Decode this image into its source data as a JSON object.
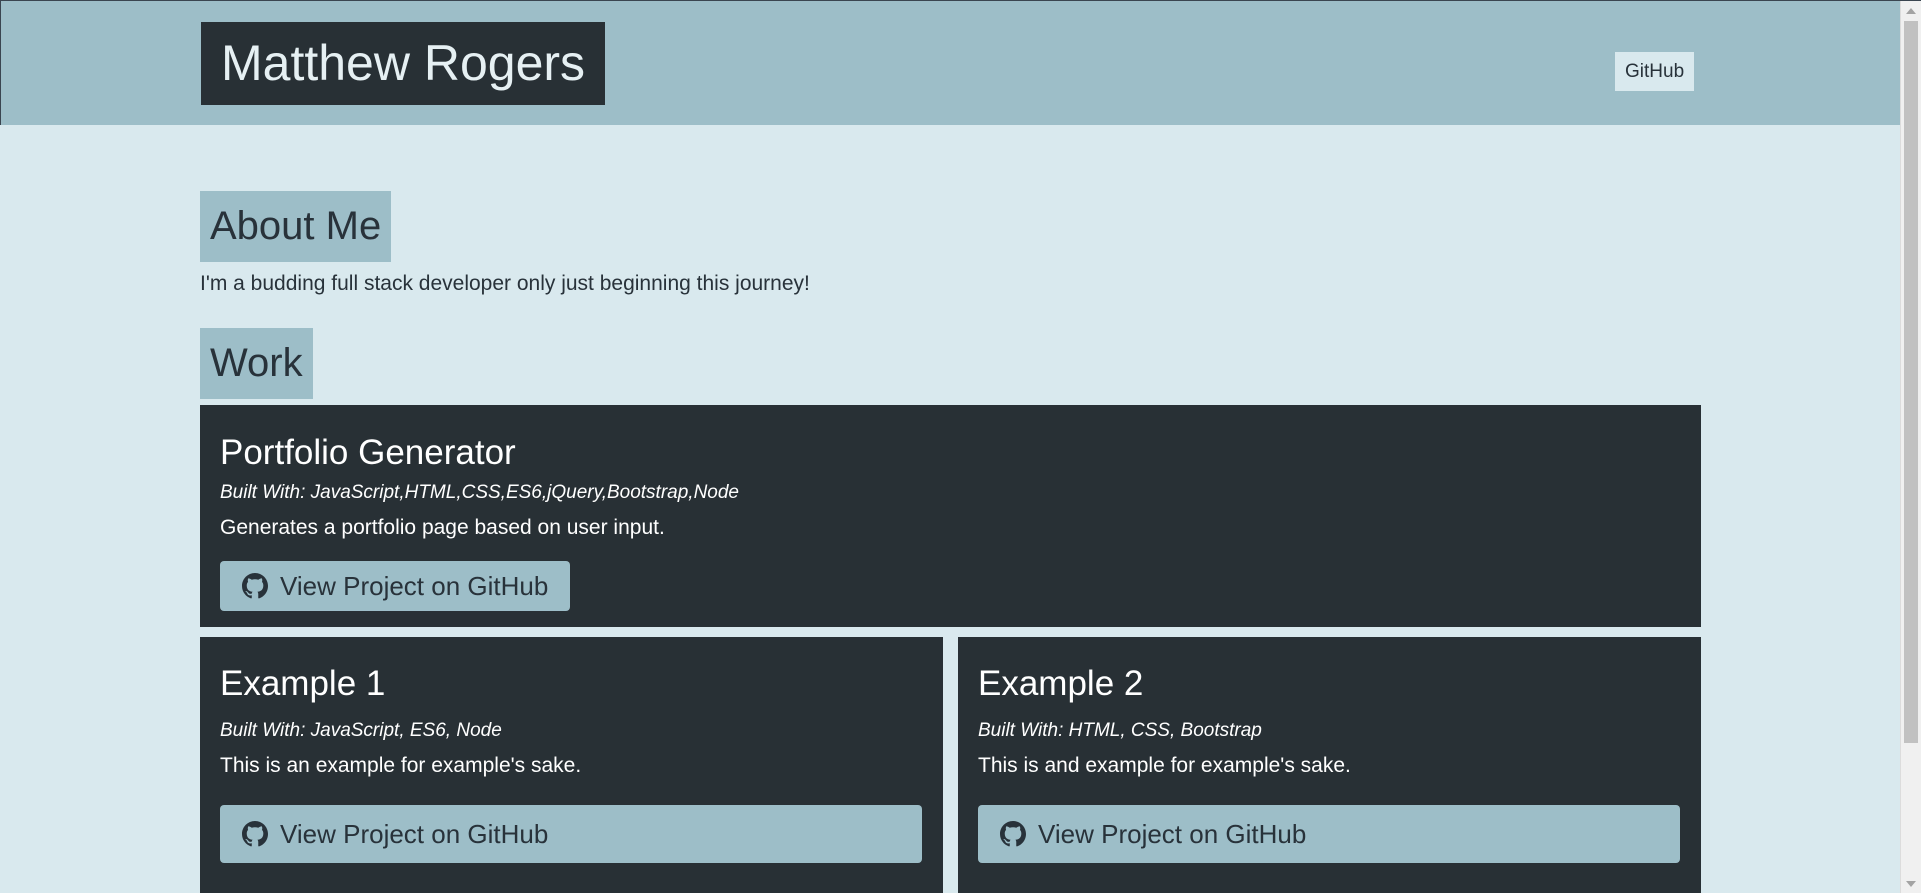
{
  "header": {
    "brand": "Matthew Rogers",
    "nav_link": "GitHub"
  },
  "about": {
    "heading": "About Me",
    "text": "I'm a budding full stack developer only just beginning this journey!"
  },
  "work": {
    "heading": "Work",
    "projects": [
      {
        "title": "Portfolio Generator",
        "built_with": "Built With: JavaScript,HTML,CSS,ES6,jQuery,Bootstrap,Node",
        "description": "Generates a portfolio page based on user input.",
        "button_label": "View Project on GitHub"
      },
      {
        "title": "Example 1",
        "built_with": "Built With: JavaScript, ES6, Node",
        "description": "This is an example for example's sake.",
        "button_label": "View Project on GitHub"
      },
      {
        "title": "Example 2",
        "built_with": "Built With: HTML, CSS, Bootstrap",
        "description": "This is and example for example's sake.",
        "button_label": "View Project on GitHub"
      }
    ]
  },
  "icons": {
    "button_icon": "github-icon"
  },
  "colors": {
    "header_bg": "#9dbec8",
    "page_bg": "#d9e9ee",
    "card_bg": "#283035",
    "text_dark": "#28323a"
  }
}
